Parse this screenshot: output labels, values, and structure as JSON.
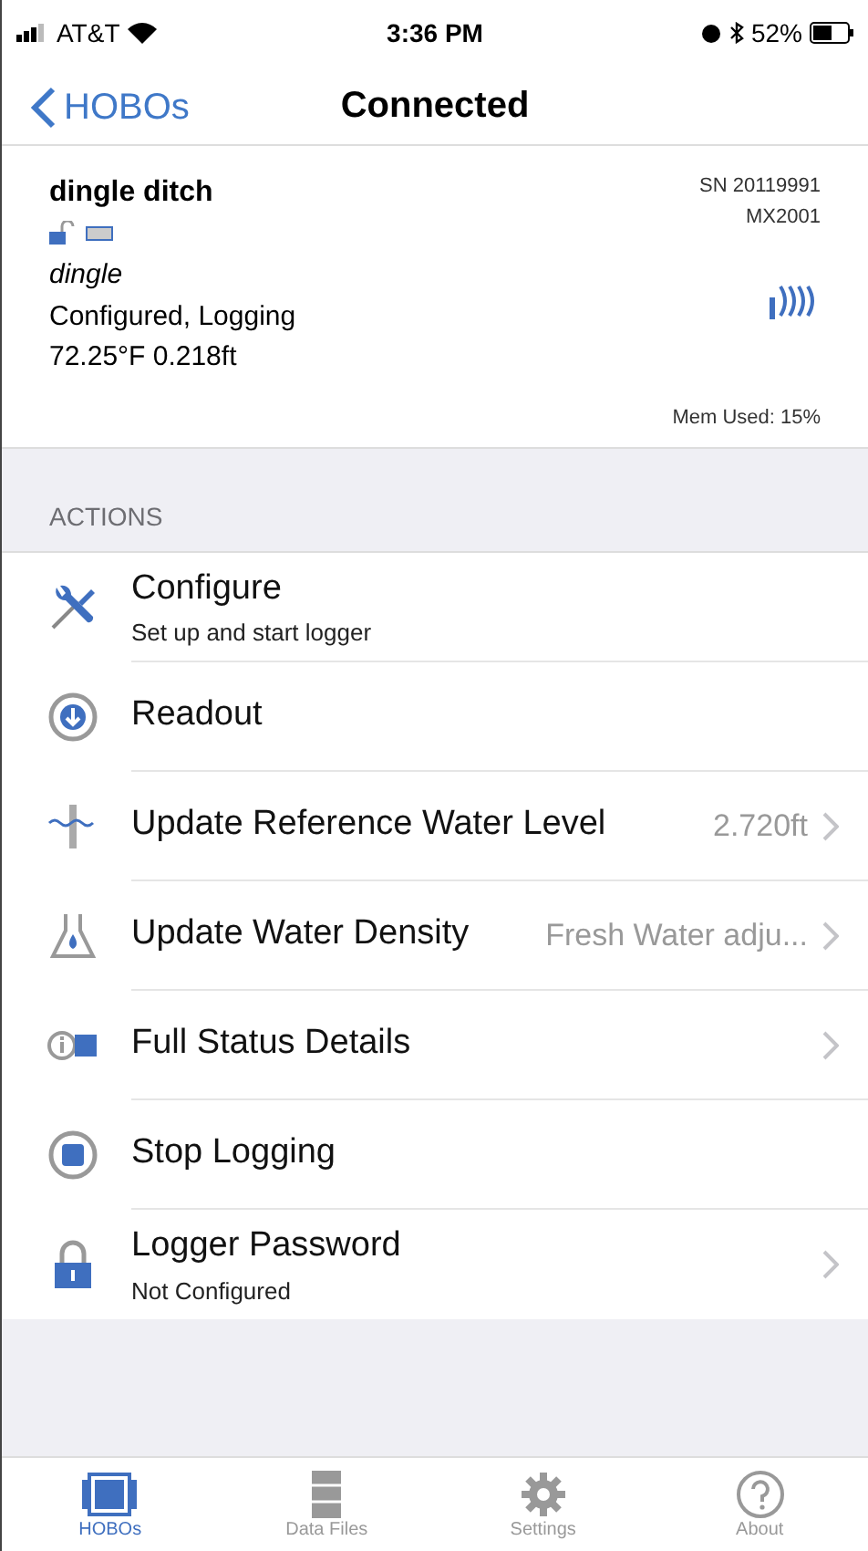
{
  "status_bar": {
    "carrier": "AT&T",
    "time": "3:36 PM",
    "battery": "52%"
  },
  "nav": {
    "back": "HOBOs",
    "title": "Connected"
  },
  "device": {
    "name": "dingle ditch",
    "serial": "SN 20119991",
    "model": "MX2001",
    "label": "dingle",
    "state": "Configured, Logging",
    "reading": "72.25°F 0.218ft",
    "memory": "Mem Used: 15%"
  },
  "section": "ACTIONS",
  "actions": [
    {
      "kind": "configure",
      "title": "Configure",
      "subtitle": "Set up and start logger",
      "chevron": false
    },
    {
      "kind": "readout",
      "title": "Readout",
      "chevron": false
    },
    {
      "kind": "water-level",
      "title": "Update Reference Water Level",
      "value": "2.720ft",
      "chevron": true
    },
    {
      "kind": "density",
      "title": "Update Water Density",
      "value": "Fresh Water adju...",
      "chevron": true
    },
    {
      "kind": "status",
      "title": "Full Status Details",
      "chevron": true
    },
    {
      "kind": "stop",
      "title": "Stop Logging",
      "chevron": false
    },
    {
      "kind": "password",
      "title": "Logger Password",
      "subtitle": "Not Configured",
      "chevron": true
    }
  ],
  "tabs": [
    {
      "kind": "hobos",
      "label": "HOBOs",
      "selected": true
    },
    {
      "kind": "files",
      "label": "Data Files",
      "selected": false
    },
    {
      "kind": "settings",
      "label": "Settings",
      "selected": false
    },
    {
      "kind": "about",
      "label": "About",
      "selected": false
    }
  ]
}
